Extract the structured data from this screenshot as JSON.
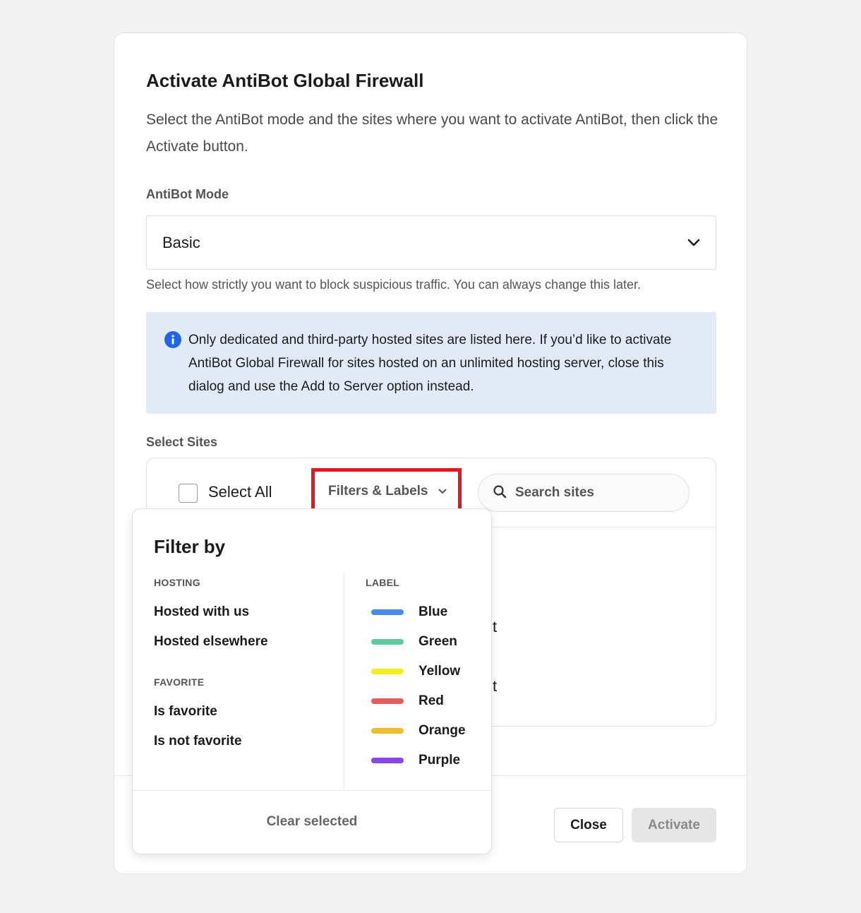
{
  "dialog": {
    "title": "Activate AntiBot Global Firewall",
    "description": "Select the AntiBot mode and the sites where you want to activate AntiBot, then click the Activate button."
  },
  "mode": {
    "label": "AntiBot Mode",
    "selected": "Basic",
    "hint": "Select how strictly you want to block suspicious traffic. You can always change this later."
  },
  "info": {
    "text": "Only dedicated and third-party hosted sites are listed here. If you’d like to activate AntiBot Global Firewall for sites hosted on an unlimited hosting server, close this dialog and use the Add to Server option instead."
  },
  "sites": {
    "label": "Select Sites",
    "select_all": "Select All",
    "filters_label": "Filters & Labels",
    "search_placeholder": "Search sites",
    "peek_1": "t",
    "peek_2": "t"
  },
  "dropdown": {
    "title": "Filter by",
    "hosting_heading": "HOSTING",
    "hosting_options": [
      "Hosted with us",
      "Hosted elsewhere"
    ],
    "favorite_heading": "FAVORITE",
    "favorite_options": [
      "Is favorite",
      "Is not favorite"
    ],
    "label_heading": "LABEL",
    "labels": [
      {
        "name": "Blue",
        "color": "#4a8ae8"
      },
      {
        "name": "Green",
        "color": "#5ecc9c"
      },
      {
        "name": "Yellow",
        "color": "#f4ee1a"
      },
      {
        "name": "Red",
        "color": "#e45d5d"
      },
      {
        "name": "Orange",
        "color": "#f1bb2c"
      },
      {
        "name": "Purple",
        "color": "#8a45e4"
      }
    ],
    "clear": "Clear selected"
  },
  "footer": {
    "close": "Close",
    "activate": "Activate"
  },
  "colors": {
    "highlight": "#e8141f",
    "info_bg": "#e3eaf7",
    "info_icon": "#2166e6"
  }
}
